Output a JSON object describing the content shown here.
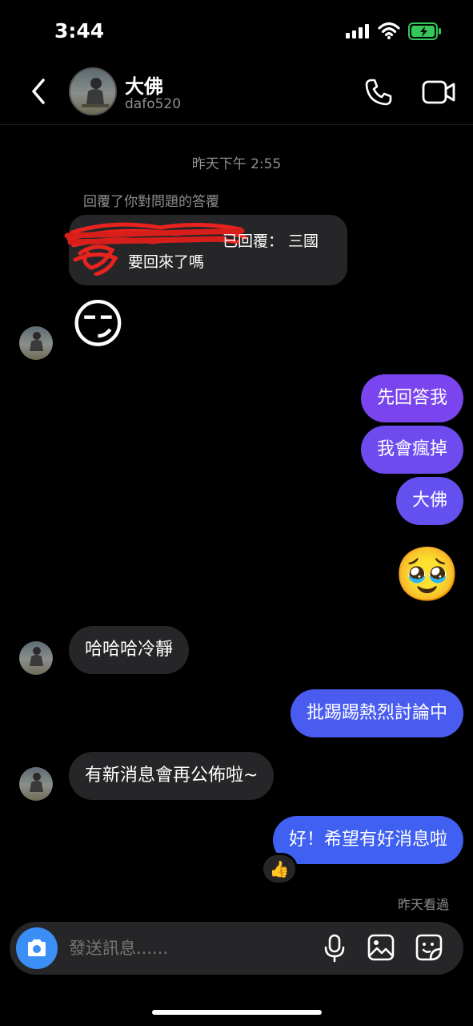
{
  "status": {
    "time": "3:44"
  },
  "header": {
    "name": "大佛",
    "handle": "dafo520"
  },
  "thread": {
    "timestamp": "昨天下午 2:55",
    "reply_note": "回覆了你對問題的答覆",
    "quote_line1": "已回覆： 三國",
    "quote_line2": "要回來了嗎",
    "messages": [
      {
        "from": "them",
        "type": "emoji",
        "text": "😏"
      },
      {
        "from": "me",
        "type": "text",
        "text": "先回答我"
      },
      {
        "from": "me",
        "type": "text",
        "text": "我會瘋掉"
      },
      {
        "from": "me",
        "type": "text",
        "text": "大佛"
      },
      {
        "from": "me",
        "type": "emoji",
        "text": "🥹"
      },
      {
        "from": "them",
        "type": "text",
        "text": "哈哈哈冷靜"
      },
      {
        "from": "me",
        "type": "text",
        "text": "批踢踢熱烈討論中"
      },
      {
        "from": "them",
        "type": "text",
        "text": "有新消息會再公佈啦~"
      },
      {
        "from": "me",
        "type": "text",
        "text": "好！希望有好消息啦"
      }
    ],
    "reaction": "👍",
    "seen": "昨天看過"
  },
  "composer": {
    "placeholder": "發送訊息......"
  },
  "colors": {
    "bubble_top": "#8a3ff0",
    "bubble_bottom": "#3f5cf0",
    "incoming": "#262628",
    "camera": "#3a8ef6"
  },
  "icons": [
    "back-chevron-icon",
    "phone-icon",
    "video-camera-icon",
    "camera-icon",
    "microphone-icon",
    "gallery-icon",
    "sticker-icon"
  ]
}
